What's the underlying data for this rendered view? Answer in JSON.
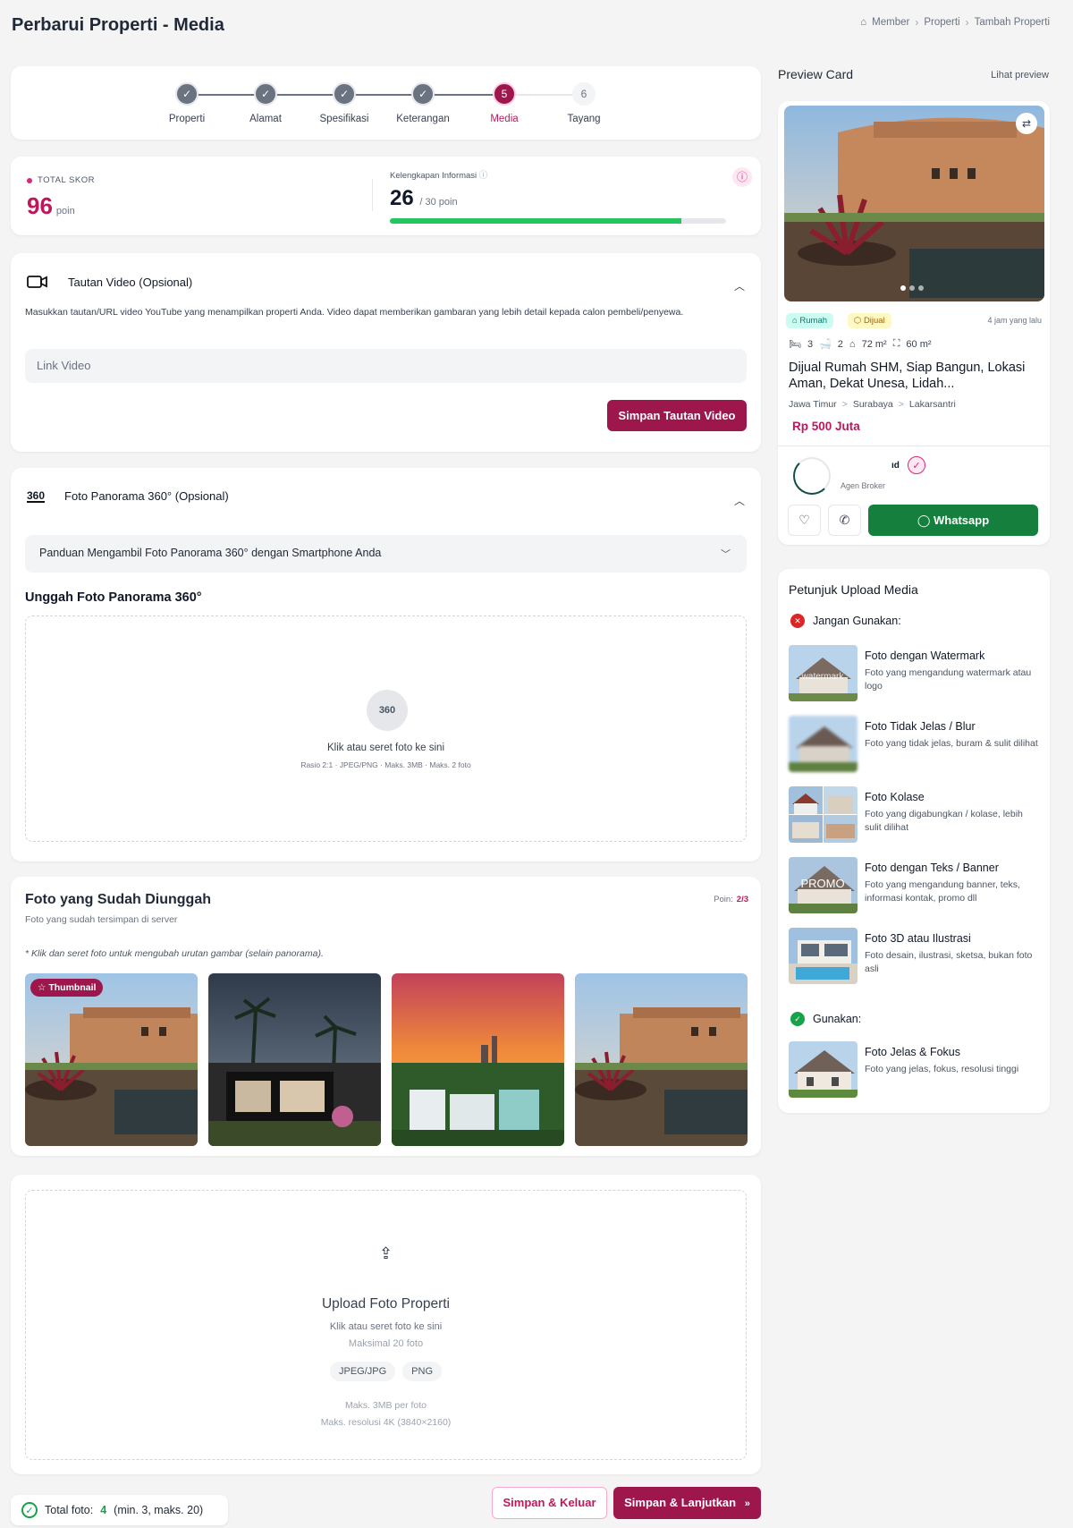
{
  "page": {
    "title": "Perbarui Properti - Media",
    "breadcrumb": [
      "Member",
      "Properti",
      "Tambah Properti"
    ]
  },
  "stepper": {
    "steps": [
      {
        "label": "Properti",
        "state": "done"
      },
      {
        "label": "Alamat",
        "state": "done"
      },
      {
        "label": "Spesifikasi",
        "state": "done"
      },
      {
        "label": "Keterangan",
        "state": "done"
      },
      {
        "label": "Media",
        "state": "active",
        "number": "5"
      },
      {
        "label": "Tayang",
        "state": "todo",
        "number": "6"
      }
    ]
  },
  "score": {
    "total_label": "TOTAL SKOR",
    "total_value": "96",
    "total_unit": "poin",
    "kelengkapan_label": "Kelengkapan Informasi",
    "kelengkapan_value": "26",
    "kelengkapan_max": "/ 30 poin",
    "kelengkapan_fraction": 0.867,
    "bar_color": "#22c55e"
  },
  "video": {
    "title": "Tautan Video (Opsional)",
    "description": "Masukkan tautan/URL video YouTube yang menampilkan properti Anda. Video dapat memberikan gambaran yang lebih detail kepada calon pembeli/penyewa.",
    "placeholder": "Link Video",
    "button": "Simpan Tautan Video"
  },
  "panorama": {
    "icon_text": "360",
    "title": "Foto Panorama 360° (Opsional)",
    "guide": "Panduan Mengambil Foto Panorama 360° dengan Smartphone Anda",
    "upload_title": "Unggah Foto Panorama 360°",
    "drop_text": "Klik atau seret foto ke sini",
    "drop_hint": "Rasio 2:1 · JPEG/PNG · Maks. 3MB · Maks. 2 foto"
  },
  "uploaded": {
    "title": "Foto yang Sudah Diunggah",
    "subtitle": "Foto yang sudah tersimpan di server",
    "points_label": "Poin:",
    "points_value": "2/3",
    "note": "* Klik dan seret foto untuk mengubah urutan gambar (selain panorama).",
    "thumbnail_badge": "Thumbnail"
  },
  "upload": {
    "title": "Upload Foto Properti",
    "line1": "Klik atau seret foto ke sini",
    "line2": "Maksimal 20 foto",
    "formats": [
      "JPEG/JPG",
      "PNG"
    ],
    "line3": "Maks. 3MB per foto",
    "line4": "Maks. resolusi 4K (3840×2160)"
  },
  "footer": {
    "total_label": "Total foto:",
    "total_value": "4",
    "total_range": "(min. 3, maks. 20)",
    "save_exit": "Simpan & Keluar",
    "save_next": "Simpan & Lanjutkan"
  },
  "preview": {
    "title": "Preview Card",
    "link": "Lihat preview",
    "tag_type": "Rumah",
    "tag_status": "Dijual",
    "time": "4 jam yang lalu",
    "beds": "3",
    "baths": "2",
    "building_area": "72 m²",
    "land_area": "60 m²",
    "property_title": "Dijual Rumah SHM, Siap Bangun, Lokasi Aman, Dekat Unesa, Lidah...",
    "location": [
      "Jawa Timur",
      "Surabaya",
      "Lakarsantri"
    ],
    "price": "Rp 500 Juta",
    "agent_name": "ıd",
    "agent_role": "Agen Broker",
    "whatsapp": "Whatsapp"
  },
  "guide": {
    "title": "Petunjuk Upload Media",
    "dont_label": "Jangan Gunakan:",
    "do_label": "Gunakan:",
    "dont_items": [
      {
        "title": "Foto dengan Watermark",
        "desc": "Foto yang mengandung watermark atau logo"
      },
      {
        "title": "Foto Tidak Jelas / Blur",
        "desc": "Foto yang tidak jelas, buram & sulit dilihat"
      },
      {
        "title": "Foto Kolase",
        "desc": "Foto yang digabungkan / kolase, lebih sulit dilihat"
      },
      {
        "title": "Foto dengan Teks / Banner",
        "desc": "Foto yang mengandung banner, teks, informasi kontak, promo dll"
      },
      {
        "title": "Foto 3D atau Ilustrasi",
        "desc": "Foto desain, ilustrasi, sketsa, bukan foto asli"
      }
    ],
    "do_items": [
      {
        "title": "Foto Jelas & Fokus",
        "desc": "Foto yang jelas, fokus, resolusi tinggi"
      }
    ],
    "watermark_text": "watermark",
    "promo_text": "PROMO"
  }
}
